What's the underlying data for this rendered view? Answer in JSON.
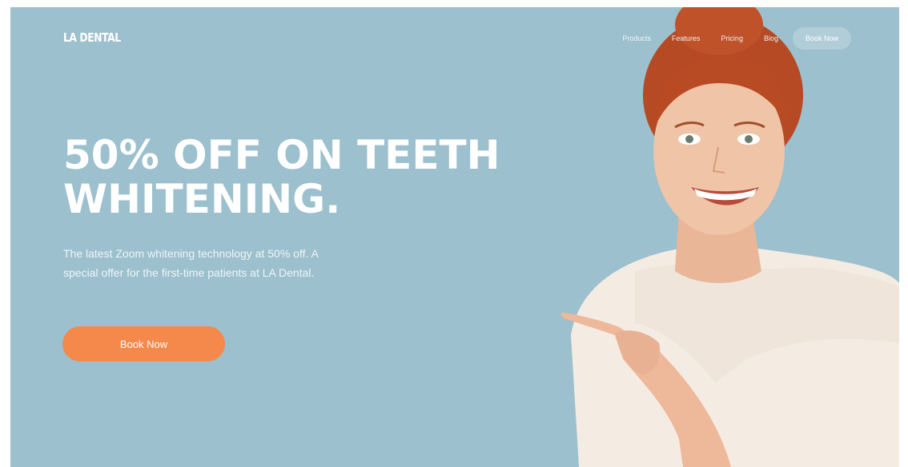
{
  "brand": {
    "logo": "LA DENTAL"
  },
  "nav": {
    "links": [
      "Products",
      "Features",
      "Pricing",
      "Blog"
    ],
    "cta": "Book Now"
  },
  "hero": {
    "title_line1": "50% OFF ON TEETH",
    "title_line2": "WHITENING.",
    "subtitle_line1": "The latest Zoom whitening technology at 50% off. A",
    "subtitle_line2": "special offer for the first-time patients at LA Dental.",
    "button": "Book Now"
  },
  "colors": {
    "background": "#9cc0cd",
    "accent": "#f4894b",
    "text": "#ffffff"
  }
}
